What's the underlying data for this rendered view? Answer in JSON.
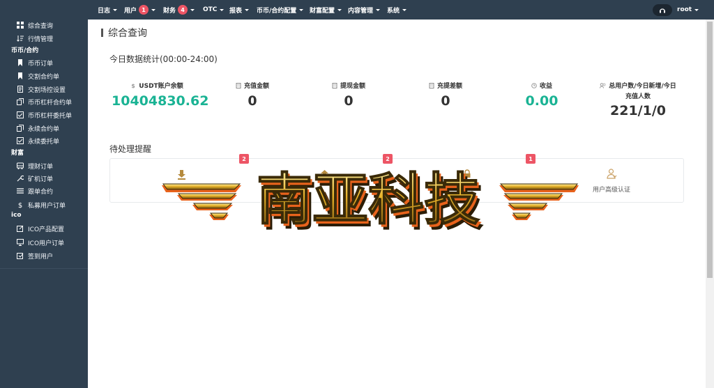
{
  "sidebar": {
    "items": [
      {
        "label": "综合查询",
        "icon": "grid-icon"
      },
      {
        "label": "行情管理",
        "icon": "sort-icon"
      },
      {
        "group": "币币/合约"
      },
      {
        "label": "币币订单",
        "icon": "bookmark-icon"
      },
      {
        "label": "交割合约单",
        "icon": "bookmark-icon"
      },
      {
        "label": "交割场控设置",
        "icon": "doc-icon"
      },
      {
        "label": "币币杠杆合约单",
        "icon": "copy-icon"
      },
      {
        "label": "币币杠杆委托单",
        "icon": "checklist-icon"
      },
      {
        "label": "永续合约单",
        "icon": "copy-icon"
      },
      {
        "label": "永续委托单",
        "icon": "checklist-icon"
      },
      {
        "group": "财富"
      },
      {
        "label": "理财订单",
        "icon": "bus-icon"
      },
      {
        "label": "矿机订单",
        "icon": "tool-icon"
      },
      {
        "label": "跟单合约",
        "icon": "list-icon"
      },
      {
        "label": "私募用户订单",
        "icon": "dollar-icon"
      },
      {
        "group": "ico"
      },
      {
        "label": "ICO产品配置",
        "icon": "edit-icon"
      },
      {
        "label": "ICO用户订单",
        "icon": "monitor-icon"
      },
      {
        "label": "签到用户",
        "icon": "signin-icon"
      }
    ]
  },
  "topnav": {
    "items": [
      {
        "label": "日志"
      },
      {
        "label": "用户",
        "badge": "1"
      },
      {
        "label": "财务",
        "badge": "4"
      },
      {
        "label": "OTC"
      },
      {
        "label": "报表"
      },
      {
        "label": "币币/合约配置"
      },
      {
        "label": "财富配置"
      },
      {
        "label": "内容管理"
      },
      {
        "label": "系统"
      }
    ],
    "user": "root"
  },
  "main": {
    "page_title": "综合查询",
    "today_title": "今日数据统计(00:00-24:00)",
    "stats": [
      {
        "label": "USDT账户余额",
        "value": "10404830.62",
        "icon": "dollar-icon",
        "green": true
      },
      {
        "label": "充值金额",
        "value": "0",
        "icon": "building-icon"
      },
      {
        "label": "提现金额",
        "value": "0",
        "icon": "building-icon"
      },
      {
        "label": "充提差额",
        "value": "0",
        "icon": "building-icon"
      },
      {
        "label": "收益",
        "value": "0.00",
        "icon": "clock-icon",
        "green": true
      },
      {
        "label_line1": "总用户数/今日新增/今日",
        "label_line2": "充值人数",
        "value": "221/1/0",
        "icon": "users-icon"
      }
    ],
    "pending_title": "待处理提醒",
    "pending": [
      {
        "badge": "2",
        "icon": "download-icon"
      },
      {
        "badge": "2",
        "icon": "upload-icon"
      },
      {
        "badge": "1",
        "icon": "lock-icon"
      },
      {
        "label": "用户高级认证",
        "icon": "user-verify-icon"
      }
    ],
    "logo_text": "南亚科技",
    "colors": {
      "sidebar_bg": "#2f4050",
      "badge_red": "#ed5565",
      "green": "#1ab394",
      "logo_gold": "#e8b32a",
      "logo_orange": "#e8631c"
    }
  }
}
